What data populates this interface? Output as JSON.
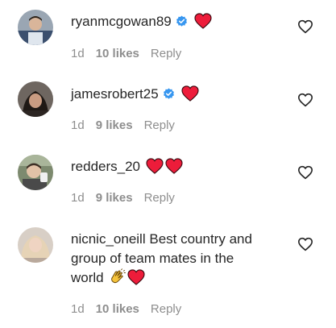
{
  "comments": [
    {
      "username": "ryanmcgowan89",
      "verified": true,
      "text": "",
      "emojis": [
        "red-heart"
      ],
      "time": "1d",
      "likes": "10 likes",
      "reply": "Reply"
    },
    {
      "username": "jamesrobert25",
      "verified": true,
      "text": "",
      "emojis": [
        "red-heart"
      ],
      "time": "1d",
      "likes": "9 likes",
      "reply": "Reply"
    },
    {
      "username": "redders_20",
      "verified": false,
      "text": "",
      "emojis": [
        "red-heart",
        "red-heart"
      ],
      "time": "1d",
      "likes": "9 likes",
      "reply": "Reply"
    },
    {
      "username": "nicnic_oneill",
      "verified": false,
      "text_line1": "Best country and",
      "text_line2": "group of team mates in the",
      "text_line3": "world",
      "emojis": [
        "clapping-hands",
        "red-heart"
      ],
      "time": "1d",
      "likes": "10 likes",
      "reply": "Reply"
    }
  ],
  "colors": {
    "text": "#262626",
    "secondary": "#8e8e8e",
    "verified": "#3897f0",
    "heart": "#ed4956"
  }
}
